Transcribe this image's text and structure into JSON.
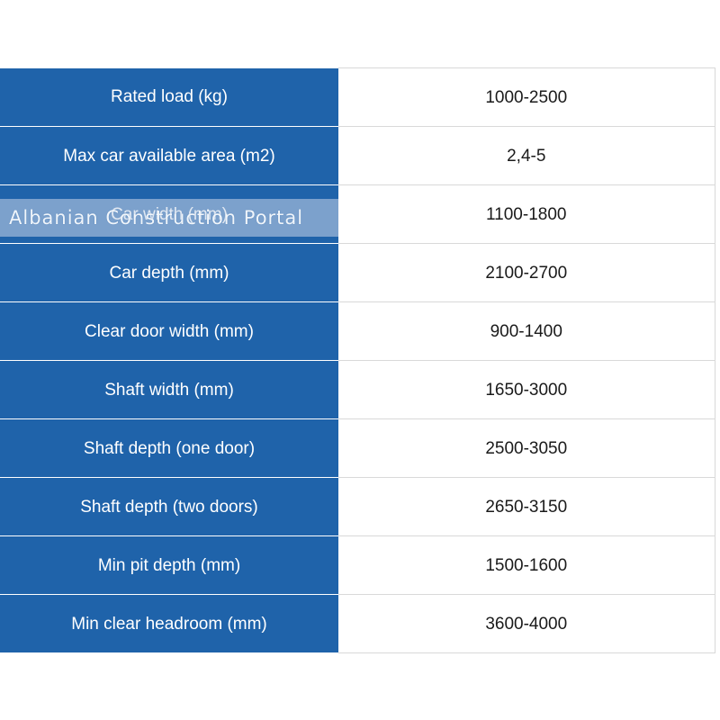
{
  "specs": [
    {
      "label": "Rated load (kg)",
      "value": "1000-2500"
    },
    {
      "label": "Max car available area (m2)",
      "value": "2,4-5"
    },
    {
      "label": "Car width (mm)",
      "value": "1100-1800"
    },
    {
      "label": "Car depth (mm)",
      "value": "2100-2700"
    },
    {
      "label": "Clear door width (mm)",
      "value": "900-1400"
    },
    {
      "label": "Shaft width (mm)",
      "value": "1650-3000"
    },
    {
      "label": "Shaft depth (one door)",
      "value": "2500-3050"
    },
    {
      "label": "Shaft depth (two doors)",
      "value": "2650-3150"
    },
    {
      "label": "Min pit depth (mm)",
      "value": "1500-1600"
    },
    {
      "label": "Min clear headroom (mm)",
      "value": "3600-4000"
    }
  ],
  "watermark": {
    "text": "Albanian Construction Portal"
  },
  "colors": {
    "label_background": "#1f63aa",
    "label_text": "#ffffff",
    "value_text": "#1a1a1a",
    "grid_line": "#d9d9d9"
  }
}
